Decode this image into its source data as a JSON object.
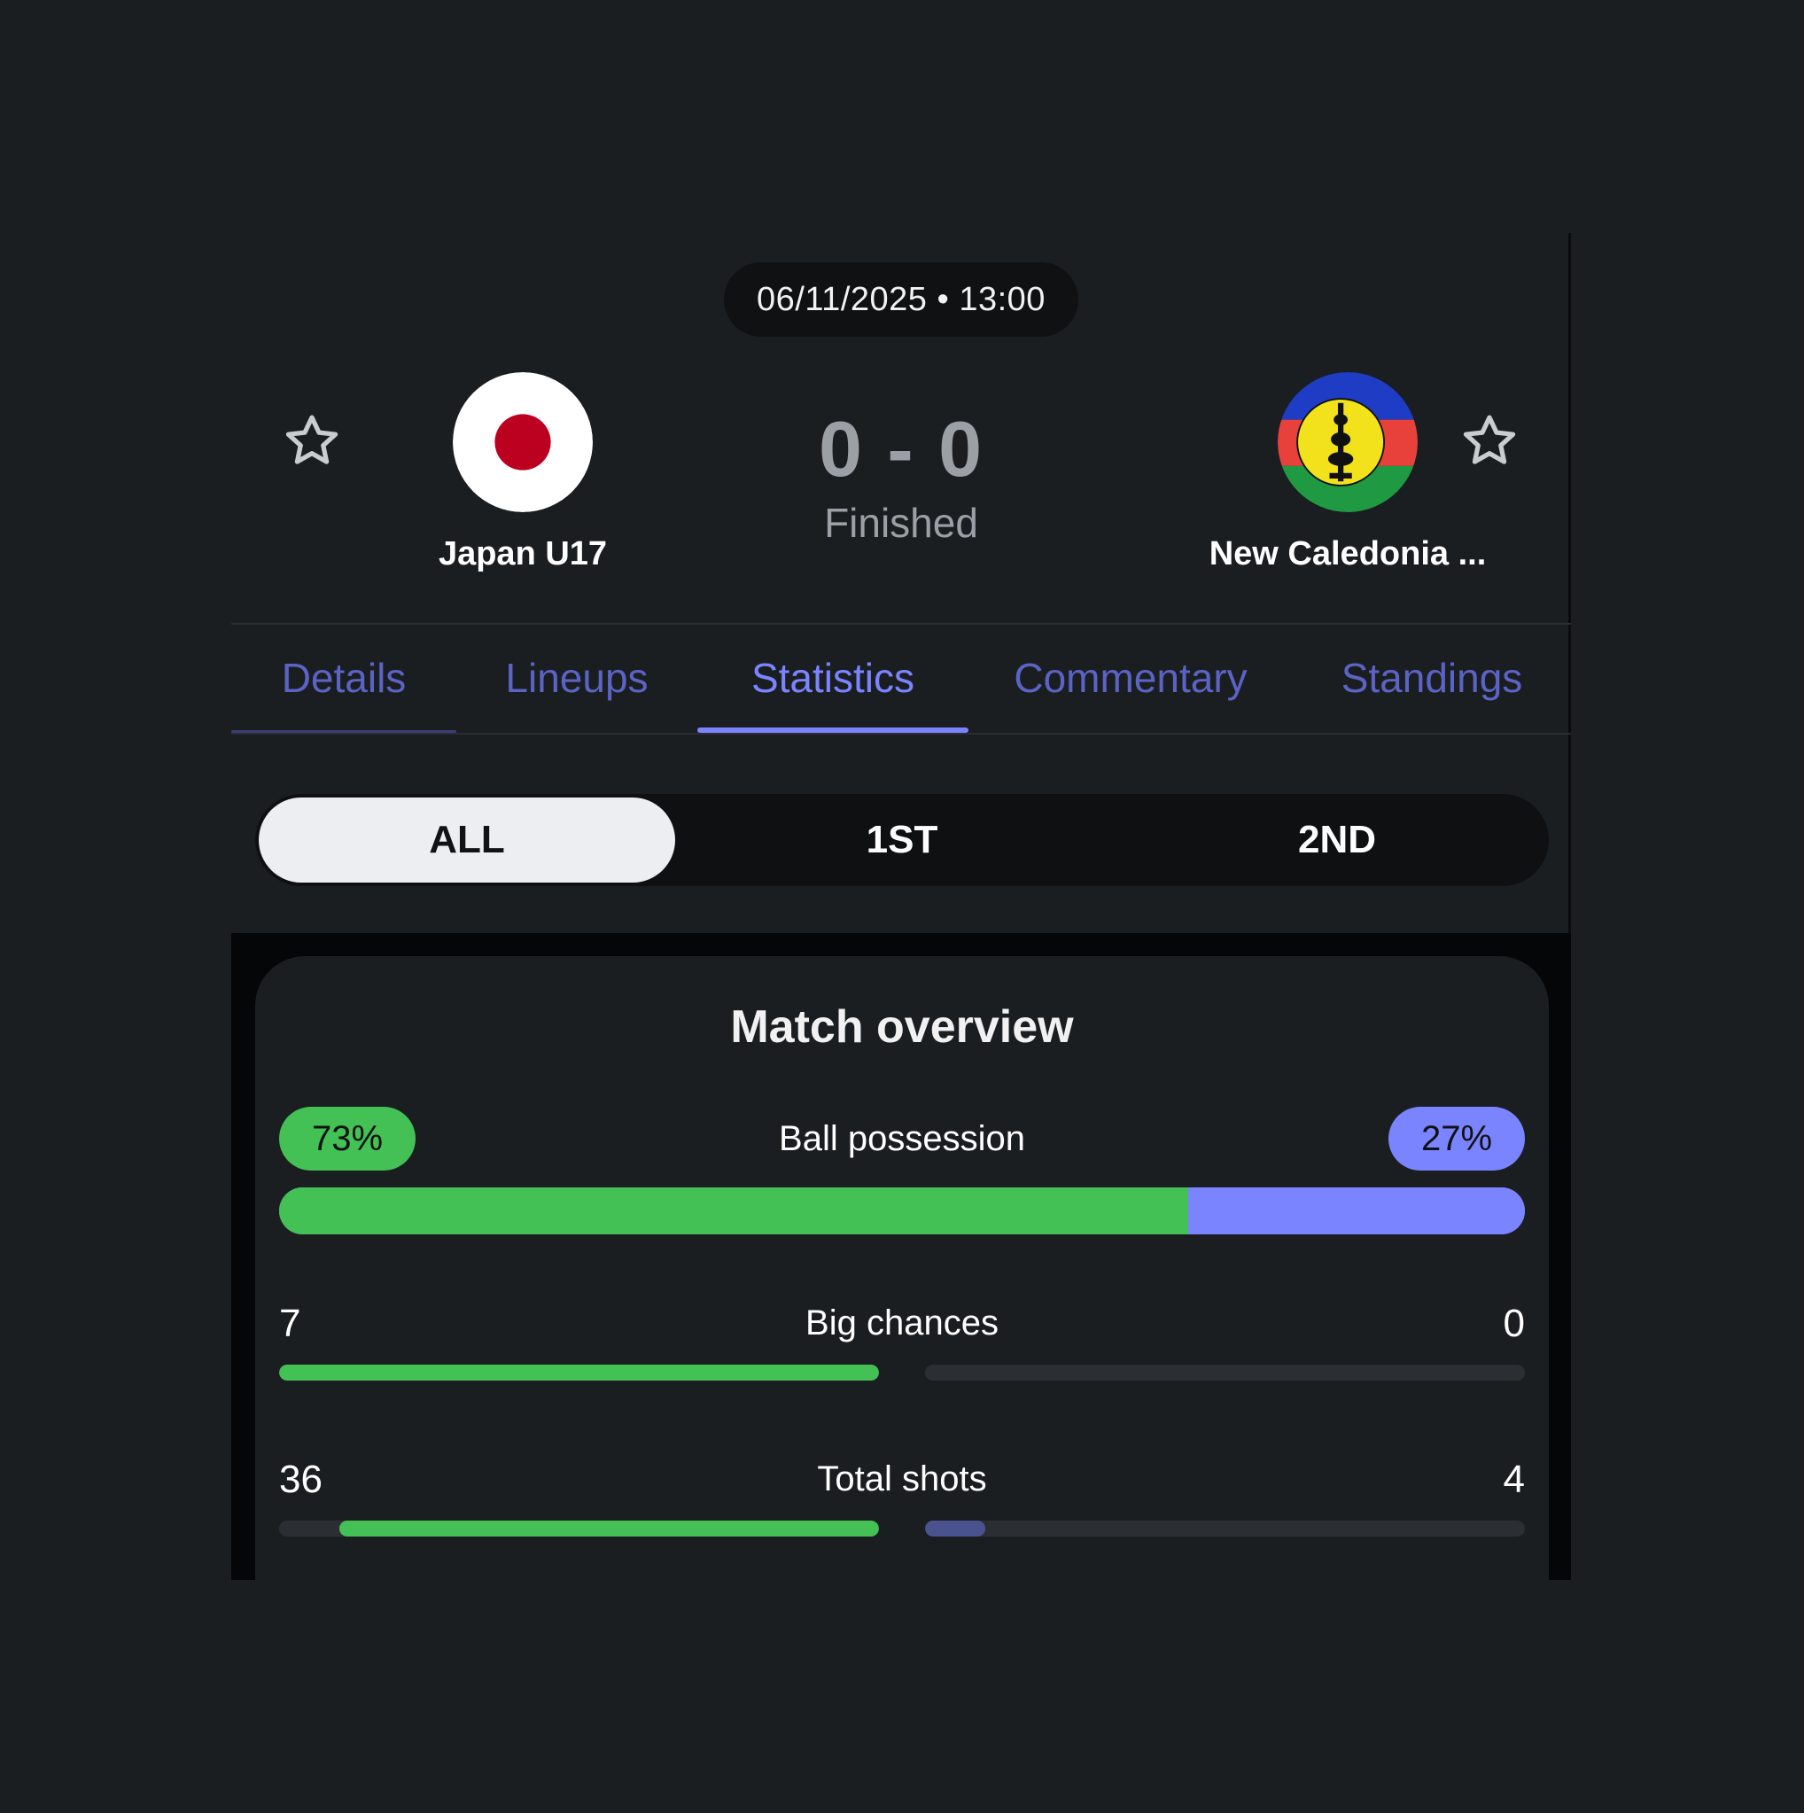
{
  "match": {
    "datetime": "06/11/2025 • 13:00",
    "score": "0 - 0",
    "status": "Finished",
    "home": {
      "name": "Japan U17",
      "flag": "japan-flag"
    },
    "away": {
      "name": "New Caledonia ...",
      "flag": "new-caledonia-flag"
    }
  },
  "tabs": [
    {
      "label": "Details"
    },
    {
      "label": "Lineups"
    },
    {
      "label": "Statistics",
      "active": true
    },
    {
      "label": "Commentary"
    },
    {
      "label": "Standings"
    }
  ],
  "period": {
    "options": [
      "ALL",
      "1ST",
      "2ND"
    ],
    "selected": "ALL"
  },
  "overview": {
    "title": "Match overview",
    "stats": [
      {
        "label": "Ball possession",
        "home": "73%",
        "away": "27%",
        "home_fraction": 0.73,
        "away_fraction": 0.27
      },
      {
        "label": "Big chances",
        "home": "7",
        "away": "0",
        "home_fraction": 1.0,
        "away_fraction": 0.0
      },
      {
        "label": "Total shots",
        "home": "36",
        "away": "4",
        "home_fraction": 0.9,
        "away_fraction": 0.1
      }
    ]
  },
  "colors": {
    "home": "#44c155",
    "away": "#7b84ff",
    "away_dim": "#4b5290",
    "tab_active": "#7b84ff",
    "tab_inactive": "#5b63c4"
  }
}
